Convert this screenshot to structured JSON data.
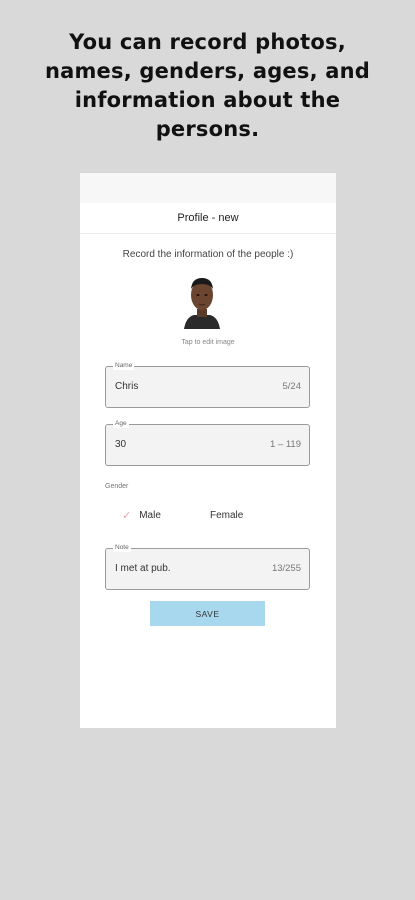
{
  "headline": {
    "line1": "You can record photos,",
    "line2": "names, genders, ages, and",
    "line3": "information about the",
    "line4": "persons."
  },
  "appbar": {
    "title": "Profile - new"
  },
  "form": {
    "subtitle": "Record the information of the people :)",
    "avatar_icon": "person-photo",
    "tap_hint": "Tap to edit image",
    "name": {
      "label": "Name",
      "value": "Chris",
      "counter": "5/24"
    },
    "age": {
      "label": "Age",
      "value": "30",
      "range": "1 – 119"
    },
    "gender": {
      "label": "Gender",
      "options": [
        "Male",
        "Female"
      ],
      "selected": "Male",
      "check_icon": "checkmark-icon"
    },
    "note": {
      "label": "Note",
      "value": "I met at pub.",
      "counter": "13/255"
    },
    "save_label": "SAVE"
  },
  "colors": {
    "background": "#d9d9d9",
    "save_button": "#a8d8ee",
    "check": "#e9a6ad"
  }
}
